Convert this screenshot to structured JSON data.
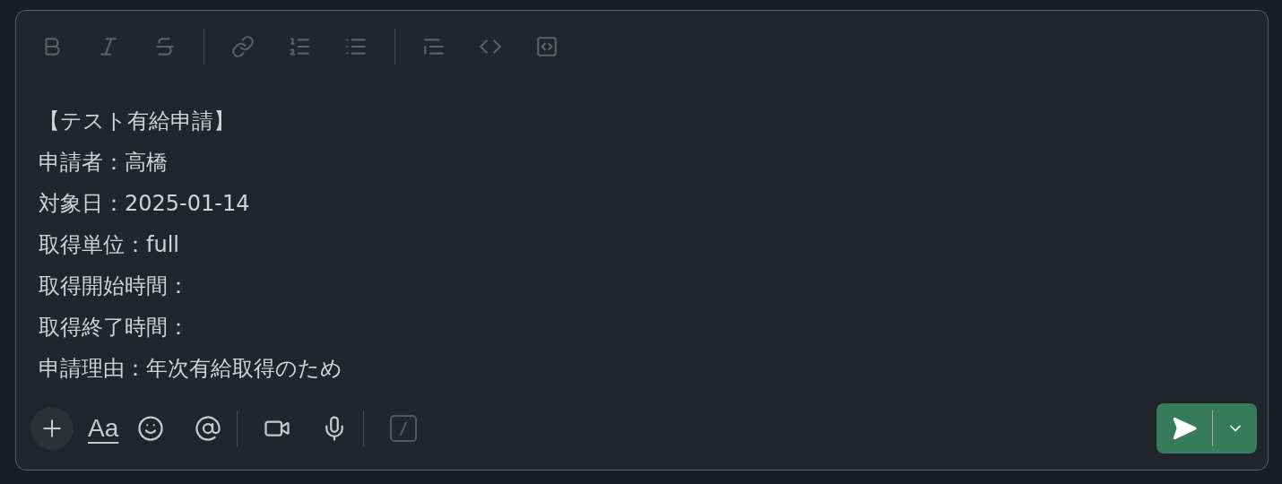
{
  "message": {
    "lines": [
      "【テスト有給申請】",
      "申請者：高橋",
      "対象日：2025-01-14",
      "取得単位：full",
      "取得開始時間：",
      "取得終了時間：",
      "申請理由：年次有給取得のため"
    ]
  },
  "composer_toolbar": {
    "formatting_label": "Aa"
  }
}
